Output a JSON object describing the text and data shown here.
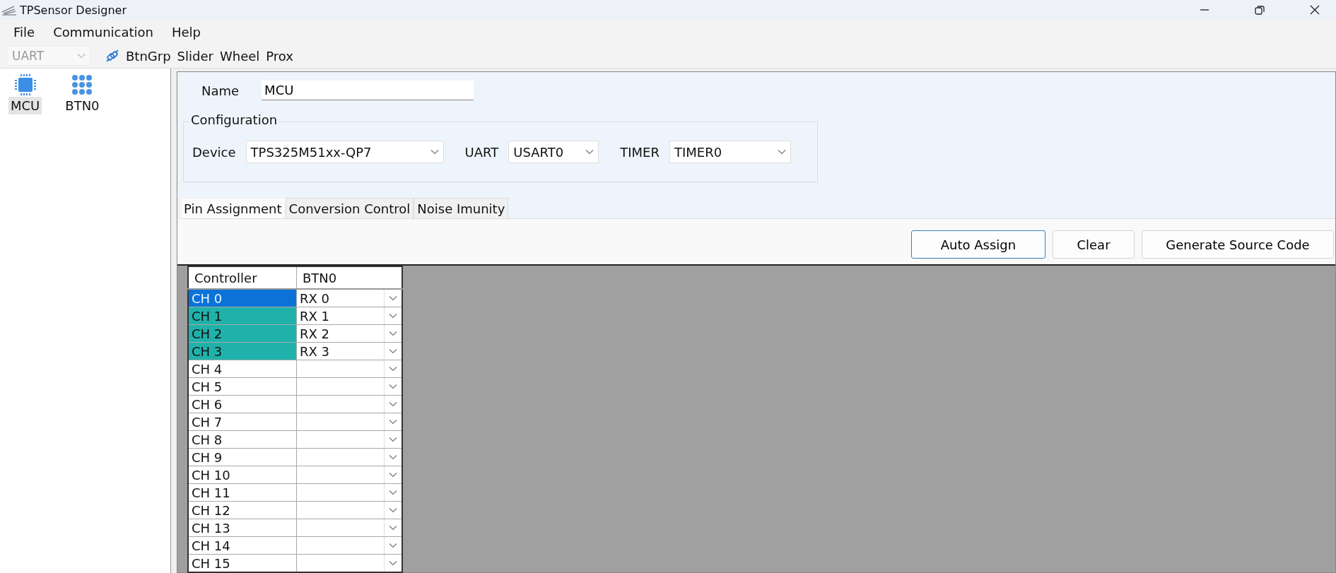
{
  "window": {
    "title": "TPSensor Designer"
  },
  "menu": [
    "File",
    "Communication",
    "Help"
  ],
  "toolbar": {
    "port": {
      "value": "UART",
      "disabled": true
    },
    "items": [
      "BtnGrp",
      "Slider",
      "Wheel",
      "Prox"
    ]
  },
  "sidebar": {
    "items": [
      {
        "label": "MCU",
        "kind": "chip",
        "selected": true
      },
      {
        "label": "BTN0",
        "kind": "buttons",
        "selected": false
      }
    ]
  },
  "form": {
    "name_label": "Name",
    "name_value": "MCU",
    "group_title": "Configuration",
    "selects": [
      {
        "label": "Device",
        "value": "TPS325M51xx-QP7"
      },
      {
        "label": "UART",
        "value": "USART0"
      },
      {
        "label": "TIMER",
        "value": "TIMER0"
      }
    ]
  },
  "tabs": [
    {
      "label": "Pin Assignment",
      "selected": true
    },
    {
      "label": "Conversion Control",
      "selected": false
    },
    {
      "label": "Noise Imunity",
      "selected": false
    }
  ],
  "buttons": [
    {
      "label": "Auto Assign",
      "focused": true
    },
    {
      "label": "Clear",
      "focused": false
    },
    {
      "label": "Generate Source Code",
      "focused": false
    }
  ],
  "table": {
    "columns": [
      "Controller",
      "BTN0"
    ],
    "rows": [
      {
        "channel": "CH 0",
        "pin": "RX 0",
        "selected": true,
        "assigned": true
      },
      {
        "channel": "CH 1",
        "pin": "RX 1",
        "selected": false,
        "assigned": true
      },
      {
        "channel": "CH 2",
        "pin": "RX 2",
        "selected": false,
        "assigned": true
      },
      {
        "channel": "CH 3",
        "pin": "RX 3",
        "selected": false,
        "assigned": true
      },
      {
        "channel": "CH 4",
        "selected": false,
        "assigned": false
      },
      {
        "channel": "CH 5",
        "selected": false,
        "assigned": false
      },
      {
        "channel": "CH 6",
        "selected": false,
        "assigned": false
      },
      {
        "channel": "CH 7",
        "selected": false,
        "assigned": false
      },
      {
        "channel": "CH 8",
        "selected": false,
        "assigned": false
      },
      {
        "channel": "CH 9",
        "selected": false,
        "assigned": false
      },
      {
        "channel": "CH 10",
        "selected": false,
        "assigned": false
      },
      {
        "channel": "CH 11",
        "selected": false,
        "assigned": false
      },
      {
        "channel": "CH 12",
        "selected": false,
        "assigned": false
      },
      {
        "channel": "CH 13",
        "selected": false,
        "assigned": false
      },
      {
        "channel": "CH 14",
        "selected": false,
        "assigned": false
      },
      {
        "channel": "CH 15",
        "selected": false,
        "assigned": false
      }
    ]
  }
}
